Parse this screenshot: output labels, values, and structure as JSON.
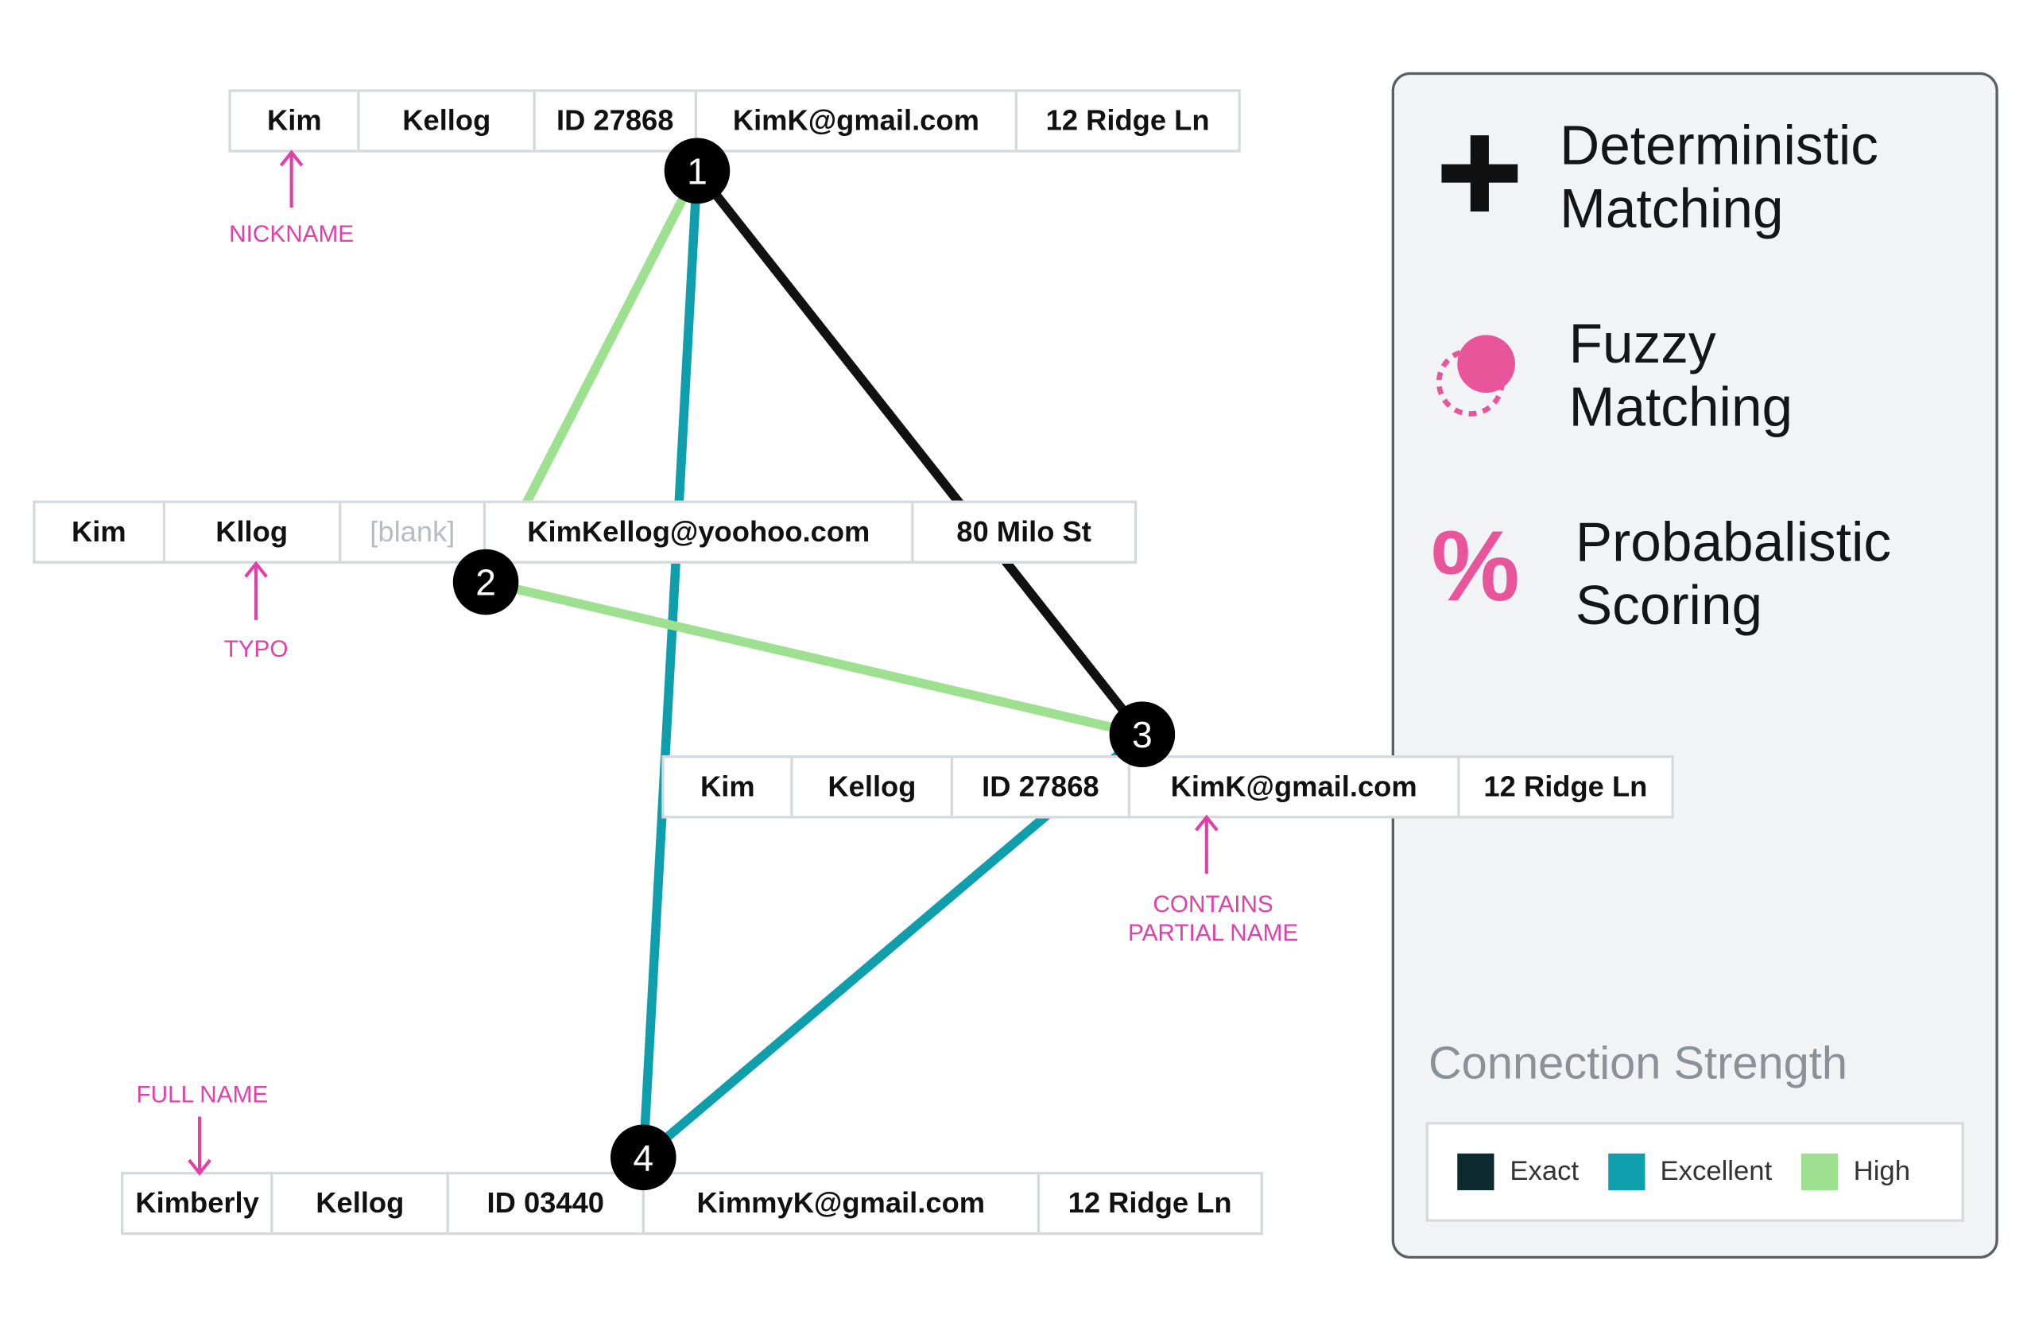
{
  "records": [
    {
      "node": "1",
      "cells": [
        "Kim",
        "Kellog",
        "ID 27868",
        "KimK@gmail.com",
        "12 Ridge Ln"
      ]
    },
    {
      "node": "2",
      "cells": [
        "Kim",
        "Kllog",
        "[blank]",
        "KimKellog@yoohoo.com",
        "80 Milo St"
      ]
    },
    {
      "node": "3",
      "cells": [
        "Kim",
        "Kellog",
        "ID 27868",
        "KimK@gmail.com",
        "12 Ridge Ln"
      ]
    },
    {
      "node": "4",
      "cells": [
        "Kimberly",
        "Kellog",
        "ID 03440",
        "KimmyK@gmail.com",
        "12 Ridge Ln"
      ]
    }
  ],
  "annotations": {
    "nickname": "NICKNAME",
    "typo": "TYPO",
    "partial_line1": "CONTAINS",
    "partial_line2": "PARTIAL NAME",
    "full_name": "FULL NAME"
  },
  "edges": [
    {
      "from": "1",
      "to": "2",
      "strength": "high"
    },
    {
      "from": "1",
      "to": "3",
      "strength": "exact"
    },
    {
      "from": "1",
      "to": "4",
      "strength": "excellent"
    },
    {
      "from": "2",
      "to": "3",
      "strength": "high"
    },
    {
      "from": "3",
      "to": "4",
      "strength": "excellent"
    }
  ],
  "methods": [
    {
      "icon": "plus-icon",
      "line1": "Deterministic",
      "line2": "Matching"
    },
    {
      "icon": "fuzzy-circles-icon",
      "line1": "Fuzzy",
      "line2": "Matching"
    },
    {
      "icon": "percent-icon",
      "line1": "Probabalistic",
      "line2": "Scoring"
    }
  ],
  "legend": {
    "title": "Connection Strength",
    "items": [
      {
        "key": "exact",
        "label": "Exact",
        "color": "#0d2b2e"
      },
      {
        "key": "excellent",
        "label": "Excellent",
        "color": "#0e9eac"
      },
      {
        "key": "high",
        "label": "High",
        "color": "#9de08f"
      }
    ]
  },
  "colors": {
    "annotation": "#e040a8",
    "node": "#000000",
    "icon_pink": "#e8559a"
  }
}
